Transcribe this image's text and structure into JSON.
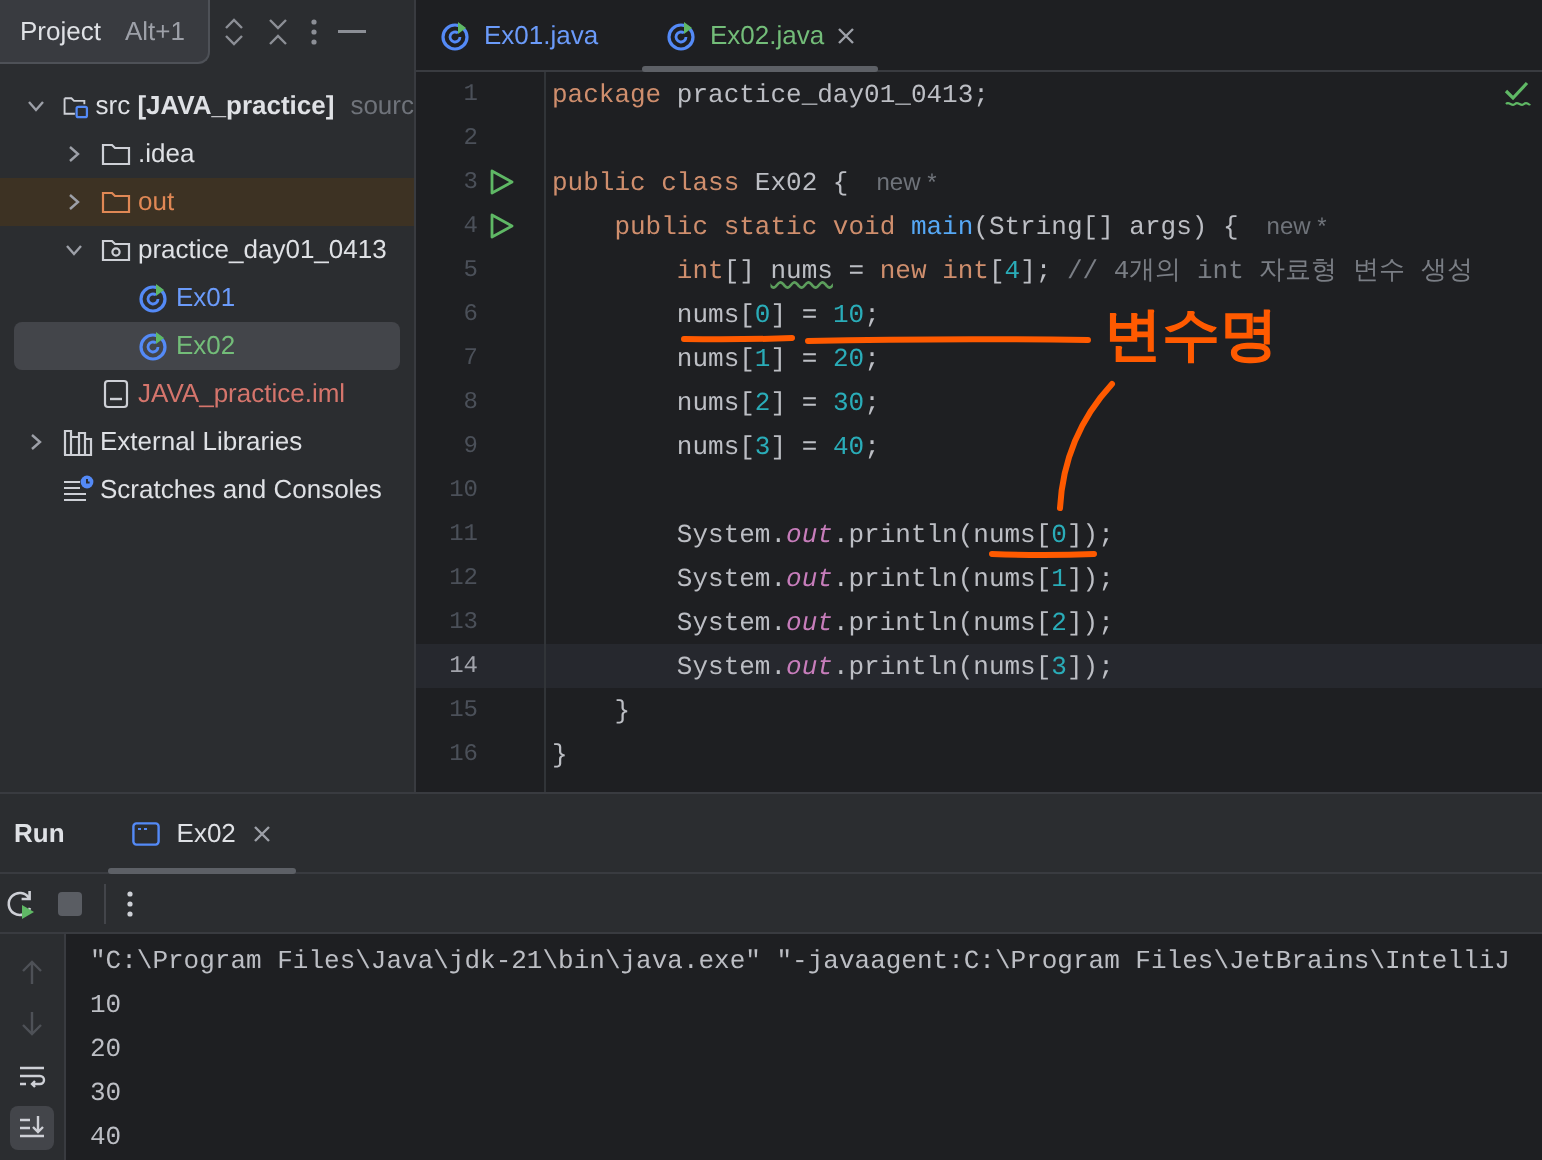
{
  "sidebar": {
    "title": "Project",
    "shortcut": "Alt+1",
    "tree": [
      {
        "kind": "folder-src",
        "label": "src **[JAVA_practice]**",
        "suffix": "sourc",
        "expanded": true,
        "selected": false,
        "excluded": false,
        "color": "#dfe1e5",
        "children": [
          {
            "kind": "folder",
            "label": ".idea",
            "expanded": false,
            "selected": false,
            "excluded": false,
            "color": "#dfe1e5"
          },
          {
            "kind": "folder",
            "label": "out",
            "expanded": false,
            "selected": false,
            "excluded": true,
            "color": "#e08855"
          },
          {
            "kind": "package",
            "label": "practice_day01_0413",
            "expanded": true,
            "selected": false,
            "excluded": false,
            "color": "#dfe1e5",
            "children": [
              {
                "kind": "java-class",
                "label": "Ex01",
                "selected": false,
                "excluded": false,
                "color": "#6b9bfa"
              },
              {
                "kind": "java-class",
                "label": "Ex02",
                "selected": true,
                "excluded": false,
                "color": "#73bd79"
              }
            ]
          },
          {
            "kind": "iml",
            "label": "JAVA_practice.iml",
            "selected": false,
            "excluded": false,
            "color": "#d5756c"
          }
        ]
      },
      {
        "kind": "libraries",
        "label": "External Libraries",
        "expanded": false,
        "selected": false,
        "excluded": false,
        "color": "#dfe1e5"
      },
      {
        "kind": "scratches",
        "label": "Scratches and Consoles",
        "selected": false,
        "excluded": false,
        "color": "#dfe1e5"
      }
    ]
  },
  "editor": {
    "tabs": [
      {
        "label": "Ex01.java",
        "color": "#6b9bfa",
        "selected": false
      },
      {
        "label": "Ex02.java",
        "color": "#73bd79",
        "selected": true
      }
    ],
    "lines": [
      {
        "number": "1",
        "run_icon": false,
        "current": false,
        "tokens": [
          {
            "kind": "keyword",
            "text": "package "
          },
          {
            "kind": "plain",
            "text": "practice_day01_0413;"
          }
        ]
      },
      {
        "number": "2",
        "run_icon": false,
        "current": false
      },
      {
        "number": "3",
        "run_icon": true,
        "current": false,
        "tokens": [
          {
            "kind": "keyword",
            "text": "public class "
          },
          {
            "kind": "plain",
            "text": "Ex02 {"
          }
        ],
        "hint": "new *"
      },
      {
        "number": "4",
        "run_icon": true,
        "current": false,
        "tokens": [
          {
            "kind": "keyword",
            "text": "    public static void "
          },
          {
            "kind": "method",
            "text": "main"
          },
          {
            "kind": "plain",
            "text": "(String[] args) {"
          }
        ],
        "hint": "new *"
      },
      {
        "number": "5",
        "run_icon": false,
        "current": false,
        "tokens": [
          {
            "kind": "keyword",
            "text": "        int"
          },
          {
            "kind": "plain",
            "text": "[] "
          },
          {
            "kind": "warning",
            "text": "nums"
          },
          {
            "kind": "plain",
            "text": " = "
          },
          {
            "kind": "keyword",
            "text": "new int"
          },
          {
            "kind": "plain",
            "text": "["
          },
          {
            "kind": "number",
            "text": "4"
          },
          {
            "kind": "plain",
            "text": "]; "
          },
          {
            "kind": "comment",
            "text": "// 4개의 int 자료형 변수 생성"
          }
        ]
      },
      {
        "number": "6",
        "run_icon": false,
        "current": false,
        "tokens": [
          {
            "kind": "plain",
            "text": "        nums["
          },
          {
            "kind": "number",
            "text": "0"
          },
          {
            "kind": "plain",
            "text": "] = "
          },
          {
            "kind": "number",
            "text": "10"
          },
          {
            "kind": "plain",
            "text": ";"
          }
        ]
      },
      {
        "number": "7",
        "run_icon": false,
        "current": false,
        "tokens": [
          {
            "kind": "plain",
            "text": "        nums["
          },
          {
            "kind": "number",
            "text": "1"
          },
          {
            "kind": "plain",
            "text": "] = "
          },
          {
            "kind": "number",
            "text": "20"
          },
          {
            "kind": "plain",
            "text": ";"
          }
        ]
      },
      {
        "number": "8",
        "run_icon": false,
        "current": false,
        "tokens": [
          {
            "kind": "plain",
            "text": "        nums["
          },
          {
            "kind": "number",
            "text": "2"
          },
          {
            "kind": "plain",
            "text": "] = "
          },
          {
            "kind": "number",
            "text": "30"
          },
          {
            "kind": "plain",
            "text": ";"
          }
        ]
      },
      {
        "number": "9",
        "run_icon": false,
        "current": false,
        "tokens": [
          {
            "kind": "plain",
            "text": "        nums["
          },
          {
            "kind": "number",
            "text": "3"
          },
          {
            "kind": "plain",
            "text": "] = "
          },
          {
            "kind": "number",
            "text": "40"
          },
          {
            "kind": "plain",
            "text": ";"
          }
        ]
      },
      {
        "number": "10",
        "run_icon": false,
        "current": false
      },
      {
        "number": "11",
        "run_icon": false,
        "current": false,
        "tokens": [
          {
            "kind": "plain",
            "text": "        System."
          },
          {
            "kind": "field",
            "text": "out"
          },
          {
            "kind": "plain",
            "text": ".println(nums["
          },
          {
            "kind": "number",
            "text": "0"
          },
          {
            "kind": "plain",
            "text": "]);"
          }
        ]
      },
      {
        "number": "12",
        "run_icon": false,
        "current": false,
        "tokens": [
          {
            "kind": "plain",
            "text": "        System."
          },
          {
            "kind": "field",
            "text": "out"
          },
          {
            "kind": "plain",
            "text": ".println(nums["
          },
          {
            "kind": "number",
            "text": "1"
          },
          {
            "kind": "plain",
            "text": "]);"
          }
        ]
      },
      {
        "number": "13",
        "run_icon": false,
        "current": false,
        "tokens": [
          {
            "kind": "plain",
            "text": "        System."
          },
          {
            "kind": "field",
            "text": "out"
          },
          {
            "kind": "plain",
            "text": ".println(nums["
          },
          {
            "kind": "number",
            "text": "2"
          },
          {
            "kind": "plain",
            "text": "]);"
          }
        ]
      },
      {
        "number": "14",
        "run_icon": false,
        "current": true,
        "tokens": [
          {
            "kind": "plain",
            "text": "        System."
          },
          {
            "kind": "field",
            "text": "out"
          },
          {
            "kind": "plain",
            "text": ".println(nums["
          },
          {
            "kind": "number",
            "text": "3"
          },
          {
            "kind": "plain",
            "text": "]);"
          }
        ]
      },
      {
        "number": "15",
        "run_icon": false,
        "current": false,
        "tokens": [
          {
            "kind": "plain",
            "text": "    }"
          }
        ]
      },
      {
        "number": "16",
        "run_icon": false,
        "current": false,
        "tokens": [
          {
            "kind": "plain",
            "text": "}"
          }
        ]
      }
    ]
  },
  "annotation": {
    "text": "변수명"
  },
  "run_panel": {
    "title": "Run",
    "tabs": [
      {
        "label": "Ex02",
        "selected": true
      }
    ],
    "toolbar": [
      {
        "kind": "rerun",
        "disabled": false
      },
      {
        "kind": "stop",
        "disabled": true
      },
      {
        "kind": "more",
        "disabled": false
      }
    ],
    "side_tools": [
      {
        "kind": "up",
        "disabled": true,
        "on": false
      },
      {
        "kind": "down",
        "disabled": true,
        "on": false
      },
      {
        "kind": "wrap",
        "disabled": false,
        "on": false
      },
      {
        "kind": "scroll-end",
        "disabled": false,
        "on": true
      }
    ],
    "console": [
      "\"C:\\Program Files\\Java\\jdk-21\\bin\\java.exe\" \"-javaagent:C:\\Program Files\\JetBrains\\IntelliJ",
      "10",
      "20",
      "30",
      "40"
    ]
  }
}
